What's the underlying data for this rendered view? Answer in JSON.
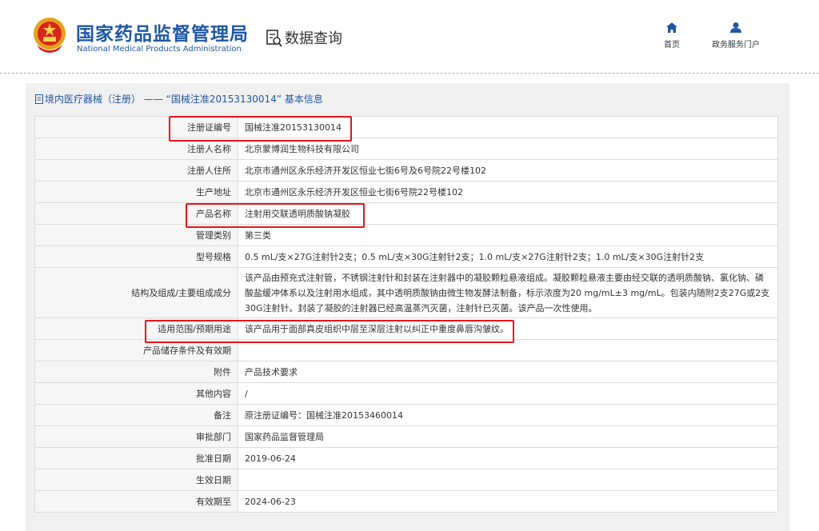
{
  "header": {
    "org_name_cn": "国家药品监督管理局",
    "org_name_en": "National Medical Products Administration",
    "data_query_label": "数据查询",
    "nav": [
      {
        "label": "首页",
        "icon": "home-icon"
      },
      {
        "label": "政务服务门户",
        "icon": "user-icon"
      }
    ]
  },
  "panel": {
    "title": "境内医疗器械（注册） —— “国械注准20153130014” 基本信息"
  },
  "table": {
    "rows": [
      {
        "label": "注册证编号",
        "value": "国械注准20153130014"
      },
      {
        "label": "注册人名称",
        "value": "北京蒙博润生物科技有限公司"
      },
      {
        "label": "注册人住所",
        "value": "北京市通州区永乐经济开发区恒业七街6号及6号院22号楼102"
      },
      {
        "label": "生产地址",
        "value": "北京市通州区永乐经济开发区恒业七街6号院22号楼102"
      },
      {
        "label": "产品名称",
        "value": "注射用交联透明质酸钠凝胶"
      },
      {
        "label": "管理类别",
        "value": "第三类"
      },
      {
        "label": "型号规格",
        "value": "0.5 mL/支×27G注射针2支；0.5 mL/支×30G注射针2支；1.0 mL/支×27G注射针2支；1.0 mL/支×30G注射针2支"
      },
      {
        "label": "结构及组成/主要组成成分",
        "value": "该产品由预充式注射管，不锈钢注射针和封装在注射器中的凝胶颗粒悬液组成。凝胶颗粒悬液主要由经交联的透明质酸钠、氯化钠、磷酸盐缓冲体系以及注射用水组成，其中透明质酸钠由微生物发酵法制备，标示浓度为20 mg/mL±3 mg/mL。包装内随附2支27G或2支30G注射针。封装了凝胶的注射器已经高温蒸汽灭菌，注射针已灭菌。该产品一次性使用。"
      },
      {
        "label": "适用范围/预期用途",
        "value": "该产品用于面部真皮组织中层至深层注射以纠正中重度鼻唇沟皱纹。"
      },
      {
        "label": "产品储存条件及有效期",
        "value": ""
      },
      {
        "label": "附件",
        "value": "产品技术要求"
      },
      {
        "label": "其他内容",
        "value": "/"
      },
      {
        "label": "备注",
        "value": "原注册证编号：国械注准20153460014"
      },
      {
        "label": "审批部门",
        "value": "国家药品监督管理局"
      },
      {
        "label": "批准日期",
        "value": "2019-06-24"
      },
      {
        "label": "生效日期",
        "value": ""
      },
      {
        "label": "有效期至",
        "value": "2024-06-23"
      }
    ]
  },
  "colors": {
    "brand_blue": "#1f57a5",
    "highlight_red": "#e8151c"
  }
}
